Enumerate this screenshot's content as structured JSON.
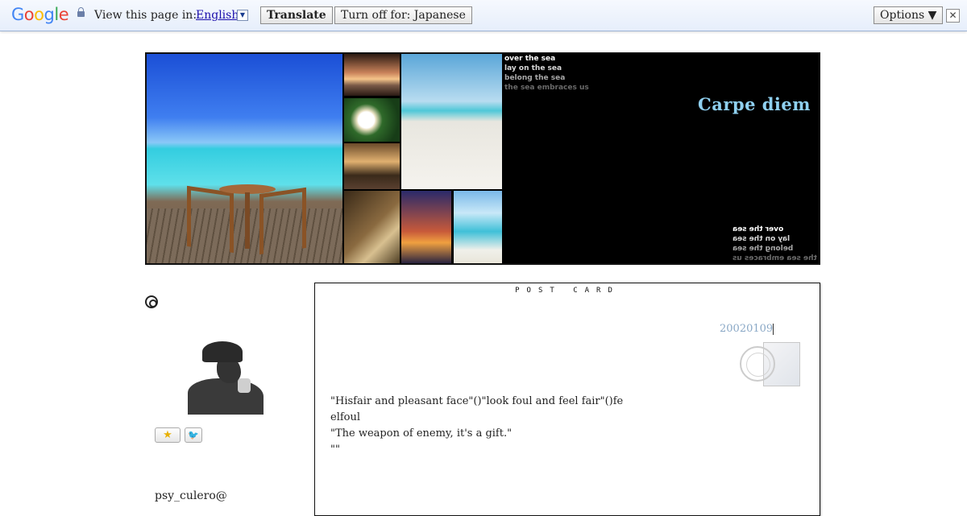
{
  "translate_bar": {
    "logo": [
      "G",
      "o",
      "o",
      "g",
      "l",
      "e"
    ],
    "logo_colors": [
      "#4285f4",
      "#ea4335",
      "#fbbc05",
      "#4285f4",
      "#34a853",
      "#ea4335"
    ],
    "view_label": "View this page in:",
    "language": "English",
    "dropdown_glyph": "▼",
    "translate_button": "Translate",
    "turn_off_button": "Turn off for: Japanese",
    "options_button": "Options ▼",
    "close_glyph": "✕"
  },
  "banner": {
    "lines": [
      "over the sea",
      "lay on the sea",
      "belong the sea",
      "the sea embraces us"
    ],
    "title": "Carpe diem",
    "title_color": "#8fd0f0"
  },
  "sidebar": {
    "star_glyph": "★",
    "twitter_glyph": "🐦",
    "username": "psy_culero@"
  },
  "postcard": {
    "header": "POST CARD",
    "date": "20020109",
    "body": [
      "\"Hisfair and pleasant face\"()\"look foul and feel fair\"()fe",
      "elfoul",
      "",
      "\"The weapon of enemy, it's a gift.\"",
      "\"\""
    ]
  }
}
